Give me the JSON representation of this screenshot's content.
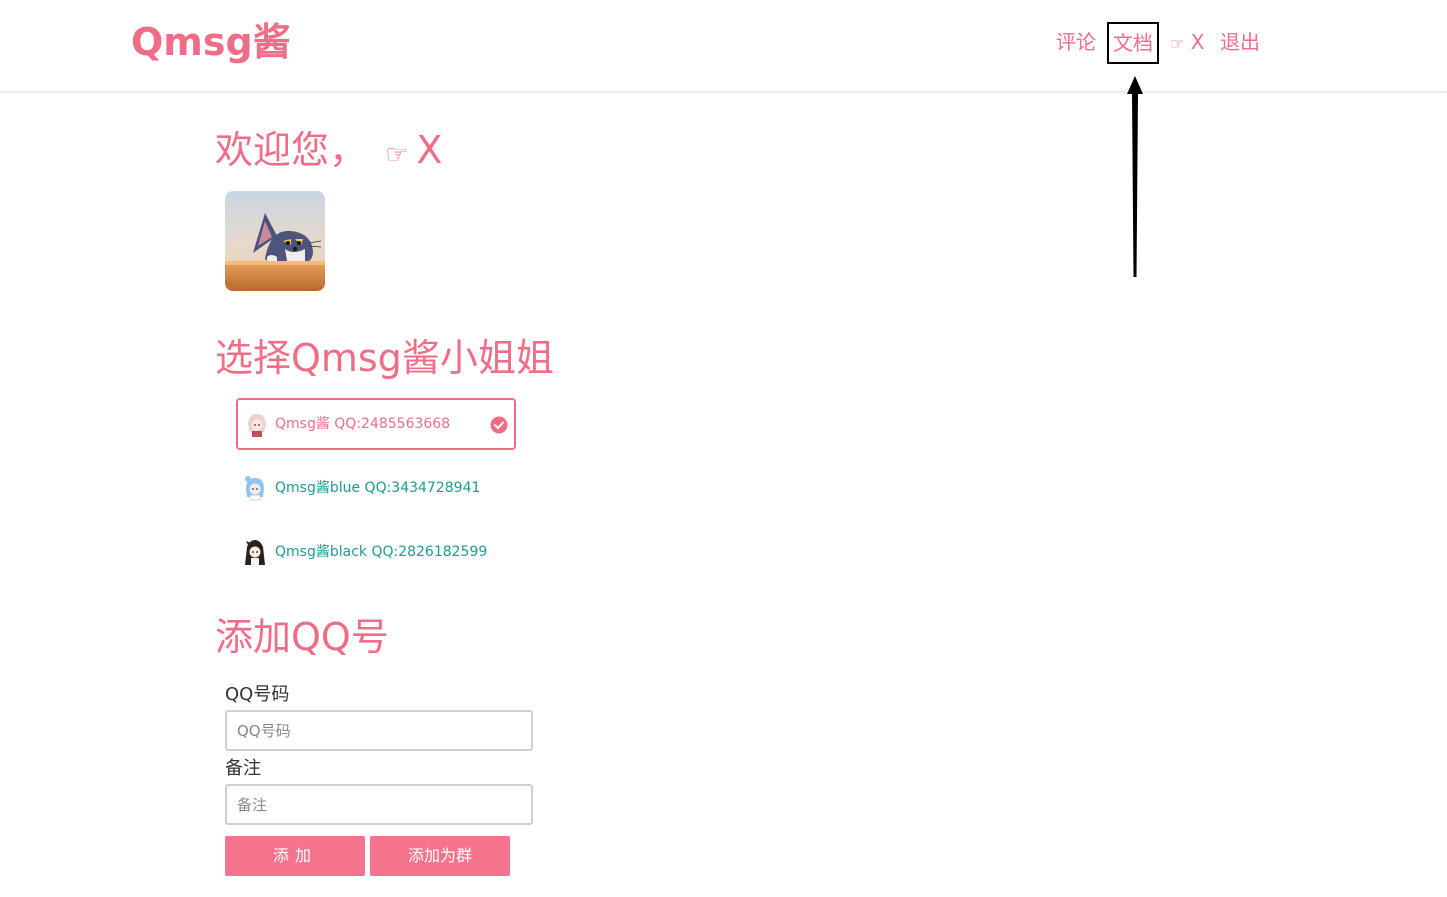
{
  "header": {
    "logo": "Qmsg酱",
    "nav": {
      "comment": "评论",
      "docs": "文档",
      "user_hand": "☞",
      "user_name": "X",
      "logout": "退出"
    }
  },
  "welcome": {
    "heading_text": "欢迎您，",
    "hand": "☞",
    "user_name": "X"
  },
  "select": {
    "heading": "选择Qmsg酱小姐姐",
    "bots": [
      {
        "label": "Qmsg酱 QQ:2485563668",
        "selected": true
      },
      {
        "label": "Qmsg酱blue QQ:3434728941",
        "selected": false
      },
      {
        "label": "Qmsg酱black QQ:2826182599",
        "selected": false
      }
    ]
  },
  "add": {
    "heading": "添加QQ号",
    "qq_label": "QQ号码",
    "qq_placeholder": "QQ号码",
    "note_label": "备注",
    "note_placeholder": "备注",
    "add_button": "添加",
    "add_group_button": "添加为群"
  },
  "colors": {
    "brand_pink": "#f06d88",
    "teal": "#1a9b94",
    "button_pink": "#f5738d"
  }
}
